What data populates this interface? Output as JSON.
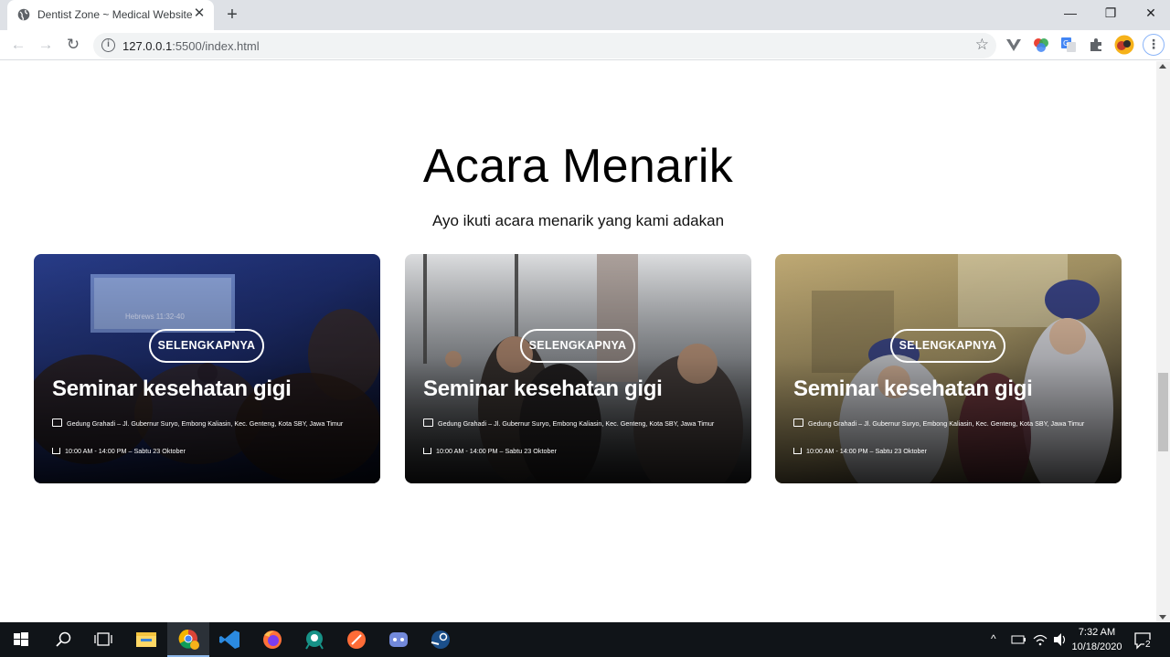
{
  "browser": {
    "tab_title": "Dentist Zone ~ Medical Website",
    "tab_close": "✕",
    "new_tab": "+",
    "url_host": "127.0.0.1",
    "url_rest": ":5500/index.html",
    "window_minimize": "—",
    "window_restore": "❐",
    "window_close": "✕",
    "back": "←",
    "forward": "→",
    "reload": "↻",
    "bookmark_star": "☆",
    "menu": "⋮",
    "site_info": "i"
  },
  "page": {
    "title": "Acara Menarik",
    "subtitle": "Ayo ikuti acara menarik yang kami adakan",
    "events": [
      {
        "button": "SELENGKAPNYA",
        "title": "Seminar kesehatan gigi",
        "location": "Gedung Grahadi – Jl. Gubernur Suryo, Embong Kaliasin, Kec. Genteng, Kota SBY, Jawa Timur",
        "time": "10:00 AM - 14:00 PM – Sabtu 23 Oktober"
      },
      {
        "button": "SELENGKAPNYA",
        "title": "Seminar kesehatan gigi",
        "location": "Gedung Grahadi – Jl. Gubernur Suryo, Embong Kaliasin, Kec. Genteng, Kota SBY, Jawa Timur",
        "time": "10:00 AM - 14:00 PM – Sabtu 23 Oktober"
      },
      {
        "button": "SELENGKAPNYA",
        "title": "Seminar kesehatan gigi",
        "location": "Gedung Grahadi – Jl. Gubernur Suryo, Embong Kaliasin, Kec. Genteng, Kota SBY, Jawa Timur",
        "time": "10:00 AM - 14:00 PM – Sabtu 23 Oktober"
      }
    ]
  },
  "taskbar": {
    "time": "7:32 AM",
    "date": "10/18/2020",
    "notification_count": "2",
    "tray_chevron": "^"
  }
}
